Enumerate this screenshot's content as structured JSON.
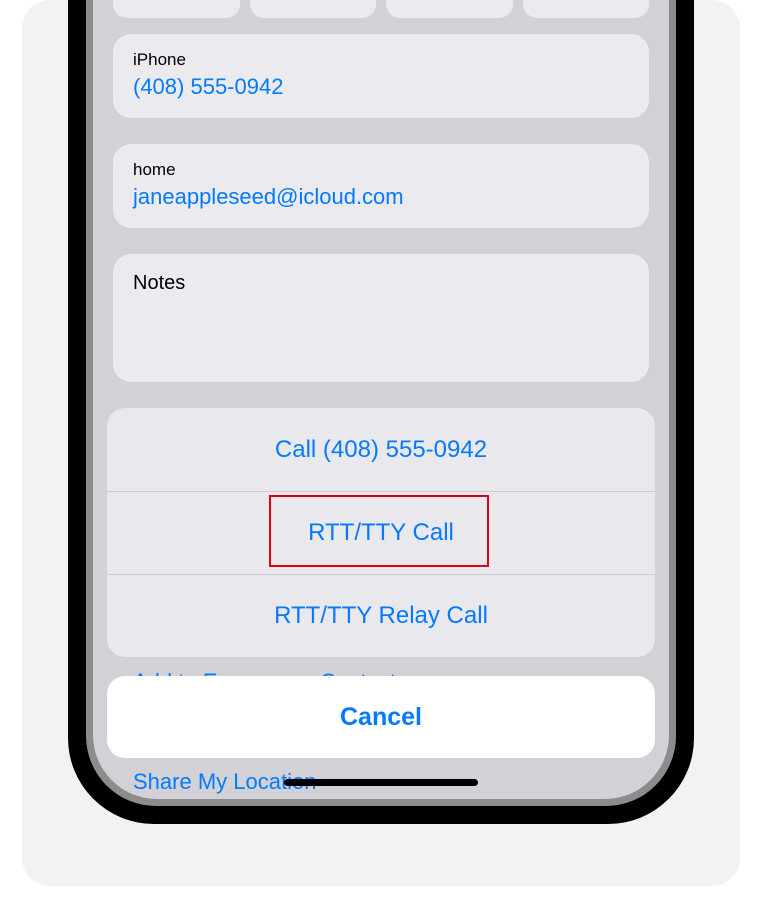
{
  "contact": {
    "phone_label": "iPhone",
    "phone_value": "(408) 555-0942",
    "email_label": "home",
    "email_value": "janeappleseed@icloud.com",
    "notes_label": "Notes"
  },
  "bg_links": {
    "emergency": "Add to Emergency Contacts",
    "share_location": "Share My Location"
  },
  "action_sheet": {
    "call": "Call (408) 555-0942",
    "rtt_tty": "RTT/TTY Call",
    "rtt_tty_relay": "RTT/TTY Relay Call",
    "cancel": "Cancel"
  }
}
